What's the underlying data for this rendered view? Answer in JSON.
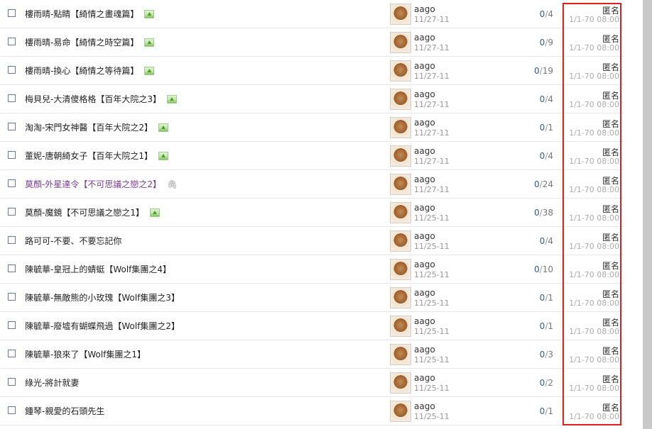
{
  "threads": [
    {
      "title": "樓雨晴-點睛【綺情之畫魂篇】",
      "attachment": "image-icon",
      "author": "aago",
      "date": "11/27-11",
      "replies": "0",
      "views": "4",
      "last_by": "匿名",
      "last_time": "1/1-70 08:00"
    },
    {
      "title": "樓雨晴-易命【綺情之時空篇】",
      "attachment": "image-icon",
      "author": "aago",
      "date": "11/27-11",
      "replies": "0",
      "views": "9",
      "last_by": "匿名",
      "last_time": "1/1-70 08:00"
    },
    {
      "title": "樓雨晴-換心【綺情之等待篇】",
      "attachment": "image-icon",
      "author": "aago",
      "date": "11/27-11",
      "replies": "0",
      "views": "19",
      "last_by": "匿名",
      "last_time": "1/1-70 08:00"
    },
    {
      "title": "梅貝兒-大清傻格格【百年大院之3】",
      "attachment": "image-icon",
      "author": "aago",
      "date": "11/27-11",
      "replies": "0",
      "views": "4",
      "last_by": "匿名",
      "last_time": "1/1-70 08:00"
    },
    {
      "title": "淘淘-宋門女神醫【百年大院之2】",
      "attachment": "image-icon",
      "author": "aago",
      "date": "11/27-11",
      "replies": "0",
      "views": "1",
      "last_by": "匿名",
      "last_time": "1/1-70 08:00"
    },
    {
      "title": "董妮-唐朝綺女子【百年大院之1】",
      "attachment": "image-icon",
      "author": "aago",
      "date": "11/27-11",
      "replies": "0",
      "views": "4",
      "last_by": "匿名",
      "last_time": "1/1-70 08:00"
    },
    {
      "title": "莫顏-外星達令【不可思議之戀之2】",
      "attachment": "paperclip-icon",
      "visited": true,
      "author": "aago",
      "date": "11/27-11",
      "replies": "0",
      "views": "24",
      "last_by": "匿名",
      "last_time": "1/1-70 08:00"
    },
    {
      "title": "莫顏-魔鏡【不可思議之戀之1】",
      "attachment": "image-icon",
      "author": "aago",
      "date": "11/25-11",
      "replies": "0",
      "views": "38",
      "last_by": "匿名",
      "last_time": "1/1-70 08:00"
    },
    {
      "title": "路可可-不要、不要忘記你",
      "attachment": "",
      "author": "aago",
      "date": "11/25-11",
      "replies": "0",
      "views": "4",
      "last_by": "匿名",
      "last_time": "1/1-70 08:00"
    },
    {
      "title": "陳毓華-皇冠上的蜻蜓【Wolf集團之4】",
      "attachment": "",
      "author": "aago",
      "date": "11/25-11",
      "replies": "0",
      "views": "10",
      "last_by": "匿名",
      "last_time": "1/1-70 08:00"
    },
    {
      "title": "陳毓華-無敵熊的小玫瑰【Wolf集團之3】",
      "attachment": "",
      "author": "aago",
      "date": "11/25-11",
      "replies": "0",
      "views": "1",
      "last_by": "匿名",
      "last_time": "1/1-70 08:00"
    },
    {
      "title": "陳毓華-廢墟有蝴蝶飛過【Wolf集團之2】",
      "attachment": "",
      "author": "aago",
      "date": "11/25-11",
      "replies": "0",
      "views": "1",
      "last_by": "匿名",
      "last_time": "1/1-70 08:00"
    },
    {
      "title": "陳毓華-狼來了【Wolf集團之1】",
      "attachment": "",
      "author": "aago",
      "date": "11/25-11",
      "replies": "0",
      "views": "3",
      "last_by": "匿名",
      "last_time": "1/1-70 08:00"
    },
    {
      "title": "綠光-將計就妻",
      "attachment": "",
      "author": "aago",
      "date": "11/25-11",
      "replies": "0",
      "views": "2",
      "last_by": "匿名",
      "last_time": "1/1-70 08:00"
    },
    {
      "title": "鍾琴-親愛的石頭先生",
      "attachment": "",
      "author": "aago",
      "date": "11/25-11",
      "replies": "0",
      "views": "1",
      "last_by": "匿名",
      "last_time": "1/1-70 08:00"
    }
  ],
  "count_separator": "/",
  "colors": {
    "accent": "#2a5d9f",
    "highlight": "#e01e1e",
    "visited": "#7b3b93"
  }
}
